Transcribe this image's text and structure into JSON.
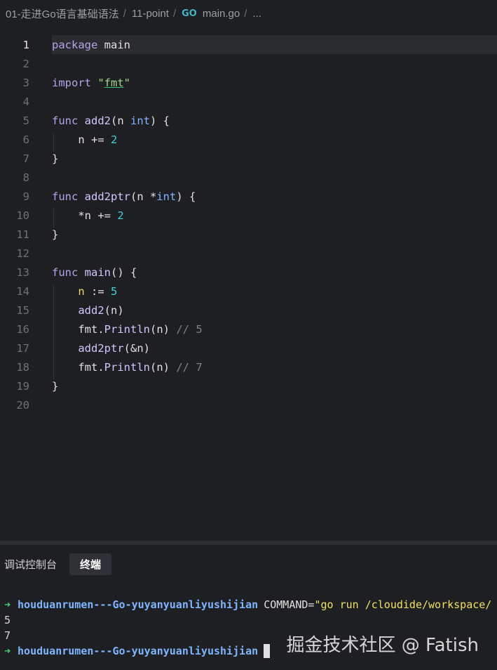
{
  "breadcrumb": {
    "segments": [
      "01-走进Go语言基础语法",
      "11-point"
    ],
    "file_icon": "go-icon",
    "file_icon_glyph": "GO",
    "file": "main.go",
    "more": "...",
    "separator": "/"
  },
  "editor": {
    "current_line": 1,
    "lines": [
      {
        "n": "1"
      },
      {
        "n": "2"
      },
      {
        "n": "3"
      },
      {
        "n": "4"
      },
      {
        "n": "5"
      },
      {
        "n": "6"
      },
      {
        "n": "7"
      },
      {
        "n": "8"
      },
      {
        "n": "9"
      },
      {
        "n": "10"
      },
      {
        "n": "11"
      },
      {
        "n": "12"
      },
      {
        "n": "13"
      },
      {
        "n": "14"
      },
      {
        "n": "15"
      },
      {
        "n": "16"
      },
      {
        "n": "17"
      },
      {
        "n": "18"
      },
      {
        "n": "19"
      },
      {
        "n": "20"
      }
    ],
    "code": {
      "l1_kw": "package",
      "l1_rest": " main",
      "l3_kw": "import",
      "l3_q1": " \"",
      "l3_str": "fmt",
      "l3_q2": "\"",
      "l5_kw": "func",
      "l5_fn": " add2",
      "l5_a": "(n ",
      "l5_ty": "int",
      "l5_b": ") {",
      "l6_a": "    n += ",
      "l6_num": "2",
      "l7": "}",
      "l9_kw": "func",
      "l9_fn": " add2ptr",
      "l9_a": "(n *",
      "l9_ty": "int",
      "l9_b": ") {",
      "l10_a": "    *n += ",
      "l10_num": "2",
      "l11": "}",
      "l13_kw": "func",
      "l13_fn": " main",
      "l13_a": "() {",
      "l14_indent": "    ",
      "l14_var": "n",
      "l14_a": " := ",
      "l14_num": "5",
      "l15_indent": "    ",
      "l15_fn": "add2",
      "l15_a": "(n)",
      "l16_indent": "    ",
      "l16_pkg": "fmt",
      "l16_dot": ".",
      "l16_fn": "Println",
      "l16_a": "(n) ",
      "l16_cm": "// 5",
      "l17_indent": "    ",
      "l17_fn": "add2ptr",
      "l17_a": "(&n)",
      "l18_indent": "    ",
      "l18_pkg": "fmt",
      "l18_dot": ".",
      "l18_fn": "Println",
      "l18_a": "(n) ",
      "l18_cm": "// 7",
      "l19": "}"
    }
  },
  "panel": {
    "tabs": [
      {
        "label": "调试控制台",
        "active": false
      },
      {
        "label": "终端",
        "active": true
      }
    ]
  },
  "terminal": {
    "arrow": "➜",
    "prompt": "houduanrumen---Go-yuyanyuanliyushijian",
    "cmd_key": "COMMAND=",
    "cmd_val": "\"go run /cloudide/workspace/",
    "outputs": [
      "5",
      "7"
    ],
    "colors": {
      "arrow": "#3fd070",
      "prompt": "#7fb4ff",
      "value": "#f0e060"
    }
  },
  "watermark": "掘金技术社区 @ Fatish"
}
